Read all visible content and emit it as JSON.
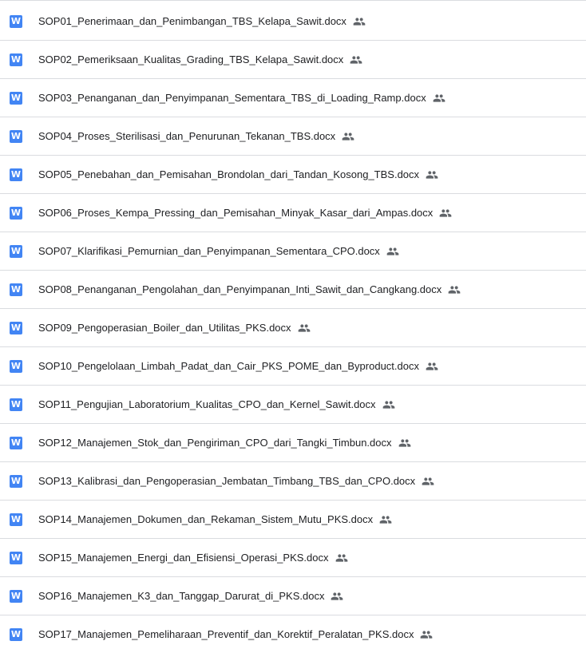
{
  "files": [
    {
      "name": "SOP01_Penerimaan_dan_Penimbangan_TBS_Kelapa_Sawit.docx",
      "icon": "word-doc-icon",
      "shared": true
    },
    {
      "name": "SOP02_Pemeriksaan_Kualitas_Grading_TBS_Kelapa_Sawit.docx",
      "icon": "word-doc-icon",
      "shared": true
    },
    {
      "name": "SOP03_Penanganan_dan_Penyimpanan_Sementara_TBS_di_Loading_Ramp.docx",
      "icon": "word-doc-icon",
      "shared": true
    },
    {
      "name": "SOP04_Proses_Sterilisasi_dan_Penurunan_Tekanan_TBS.docx",
      "icon": "word-doc-icon",
      "shared": true
    },
    {
      "name": "SOP05_Penebahan_dan_Pemisahan_Brondolan_dari_Tandan_Kosong_TBS.docx",
      "icon": "word-doc-icon",
      "shared": true
    },
    {
      "name": "SOP06_Proses_Kempa_Pressing_dan_Pemisahan_Minyak_Kasar_dari_Ampas.docx",
      "icon": "word-doc-icon",
      "shared": true
    },
    {
      "name": "SOP07_Klarifikasi_Pemurnian_dan_Penyimpanan_Sementara_CPO.docx",
      "icon": "word-doc-icon",
      "shared": true
    },
    {
      "name": "SOP08_Penanganan_Pengolahan_dan_Penyimpanan_Inti_Sawit_dan_Cangkang.docx",
      "icon": "word-doc-icon",
      "shared": true
    },
    {
      "name": "SOP09_Pengoperasian_Boiler_dan_Utilitas_PKS.docx",
      "icon": "word-doc-icon",
      "shared": true
    },
    {
      "name": "SOP10_Pengelolaan_Limbah_Padat_dan_Cair_PKS_POME_dan_Byproduct.docx",
      "icon": "word-doc-icon",
      "shared": true
    },
    {
      "name": "SOP11_Pengujian_Laboratorium_Kualitas_CPO_dan_Kernel_Sawit.docx",
      "icon": "word-doc-icon",
      "shared": true
    },
    {
      "name": "SOP12_Manajemen_Stok_dan_Pengiriman_CPO_dari_Tangki_Timbun.docx",
      "icon": "word-doc-icon",
      "shared": true
    },
    {
      "name": "SOP13_Kalibrasi_dan_Pengoperasian_Jembatan_Timbang_TBS_dan_CPO.docx",
      "icon": "word-doc-icon",
      "shared": true
    },
    {
      "name": "SOP14_Manajemen_Dokumen_dan_Rekaman_Sistem_Mutu_PKS.docx",
      "icon": "word-doc-icon",
      "shared": true
    },
    {
      "name": "SOP15_Manajemen_Energi_dan_Efisiensi_Operasi_PKS.docx",
      "icon": "word-doc-icon",
      "shared": true
    },
    {
      "name": "SOP16_Manajemen_K3_dan_Tanggap_Darurat_di_PKS.docx",
      "icon": "word-doc-icon",
      "shared": true
    },
    {
      "name": "SOP17_Manajemen_Pemeliharaan_Preventif_dan_Korektif_Peralatan_PKS.docx",
      "icon": "word-doc-icon",
      "shared": true
    }
  ],
  "word_icon_letter": "W",
  "colors": {
    "word_icon_bg": "#4285f4",
    "shared_icon": "#5f6368",
    "divider": "#dadce0",
    "text": "#202124"
  }
}
